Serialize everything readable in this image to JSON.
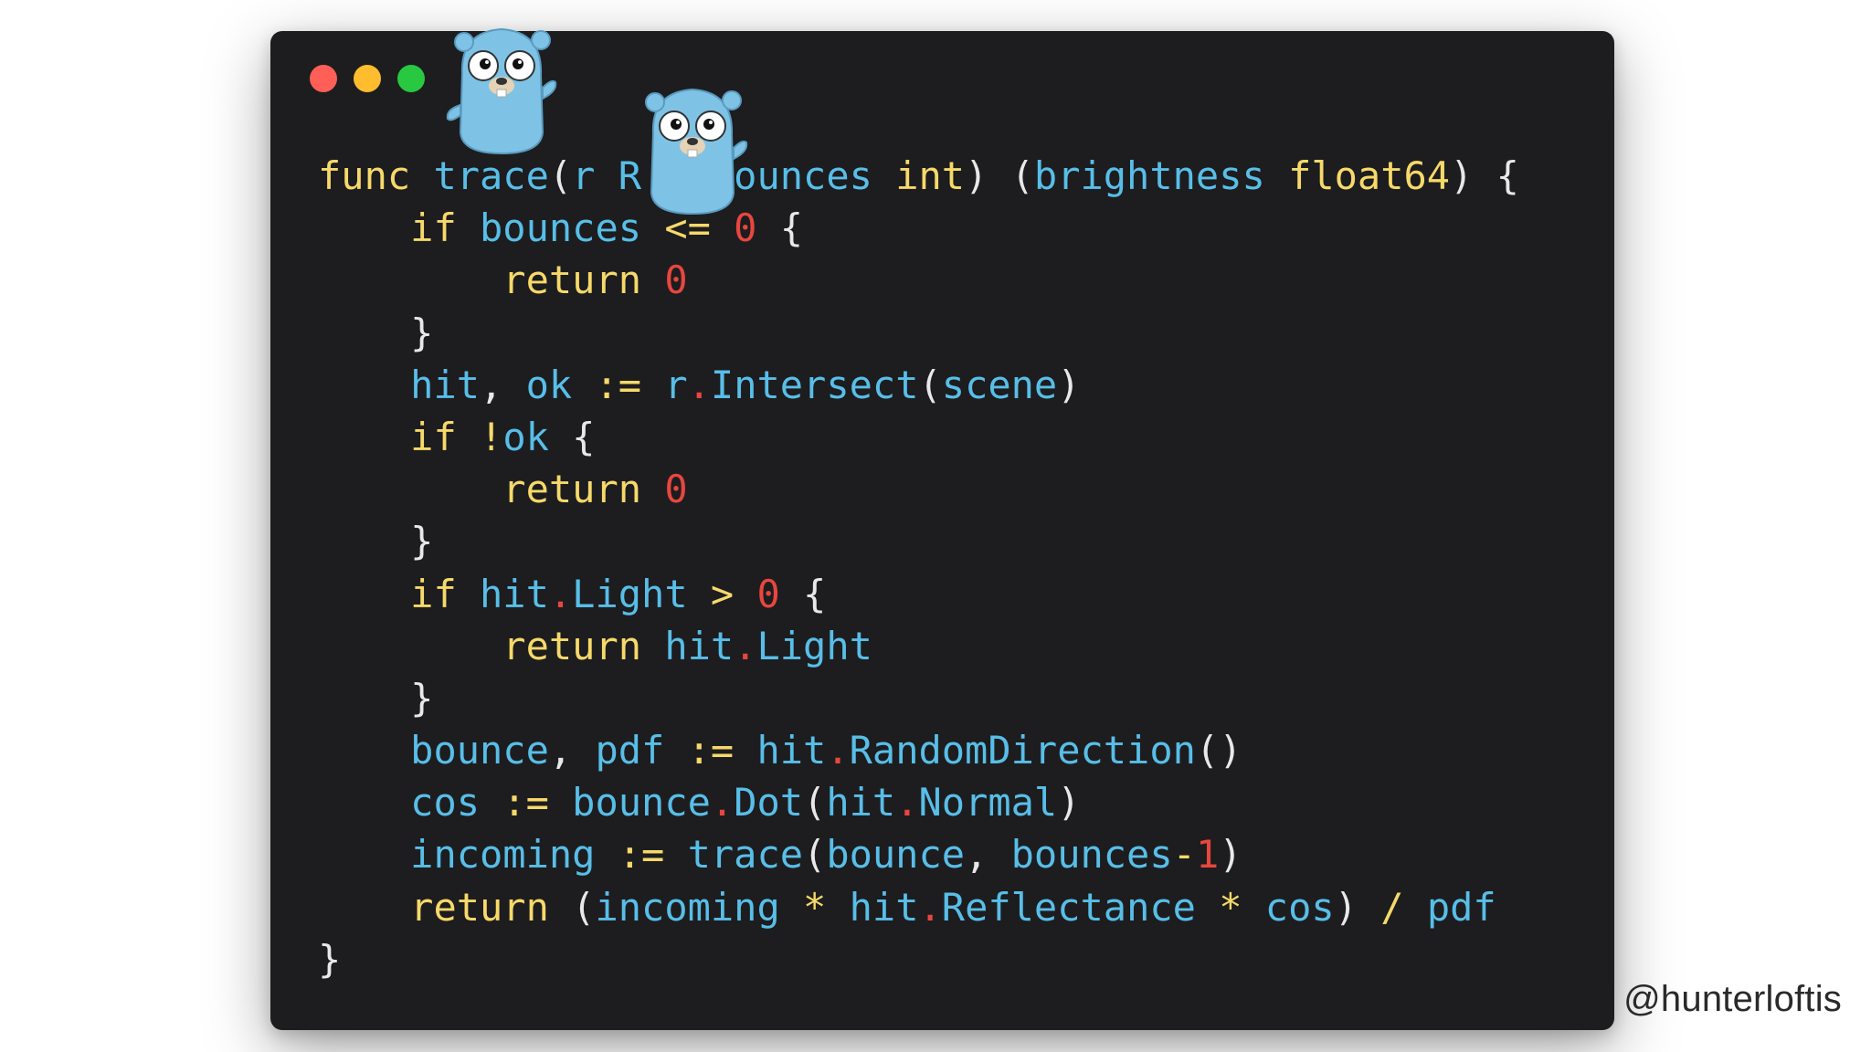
{
  "window": {
    "traffic_lights": [
      {
        "name": "close",
        "color": "#ff5f57"
      },
      {
        "name": "minimize",
        "color": "#febc2e"
      },
      {
        "name": "zoom",
        "color": "#28c840"
      }
    ]
  },
  "code": {
    "language": "go",
    "lines": [
      [
        [
          "kw",
          "func "
        ],
        [
          "id",
          "trace"
        ],
        [
          "punc",
          "("
        ],
        [
          "id",
          "r R"
        ],
        [
          "punc",
          "   "
        ],
        [
          "id",
          "bounces "
        ],
        [
          "kw",
          "int"
        ],
        [
          "punc",
          ") ("
        ],
        [
          "id",
          "brightness "
        ],
        [
          "kw",
          "float64"
        ],
        [
          "punc",
          ") {"
        ]
      ],
      [
        [
          "punc",
          "    "
        ],
        [
          "kw",
          "if "
        ],
        [
          "id",
          "bounces "
        ],
        [
          "op",
          "<= "
        ],
        [
          "num",
          "0"
        ],
        [
          "punc",
          " {"
        ]
      ],
      [
        [
          "punc",
          "        "
        ],
        [
          "kw",
          "return "
        ],
        [
          "num",
          "0"
        ]
      ],
      [
        [
          "punc",
          "    }"
        ]
      ],
      [
        [
          "punc",
          "    "
        ],
        [
          "id",
          "hit"
        ],
        [
          "punc",
          ", "
        ],
        [
          "id",
          "ok "
        ],
        [
          "op",
          ":= "
        ],
        [
          "id",
          "r"
        ],
        [
          "dotop",
          "."
        ],
        [
          "id",
          "Intersect"
        ],
        [
          "punc",
          "("
        ],
        [
          "id",
          "scene"
        ],
        [
          "punc",
          ")"
        ]
      ],
      [
        [
          "punc",
          "    "
        ],
        [
          "kw",
          "if "
        ],
        [
          "op",
          "!"
        ],
        [
          "id",
          "ok"
        ],
        [
          "punc",
          " {"
        ]
      ],
      [
        [
          "punc",
          "        "
        ],
        [
          "kw",
          "return "
        ],
        [
          "num",
          "0"
        ]
      ],
      [
        [
          "punc",
          "    }"
        ]
      ],
      [
        [
          "punc",
          "    "
        ],
        [
          "kw",
          "if "
        ],
        [
          "id",
          "hit"
        ],
        [
          "dotop",
          "."
        ],
        [
          "id",
          "Light "
        ],
        [
          "op",
          "> "
        ],
        [
          "num",
          "0"
        ],
        [
          "punc",
          " {"
        ]
      ],
      [
        [
          "punc",
          "        "
        ],
        [
          "kw",
          "return "
        ],
        [
          "id",
          "hit"
        ],
        [
          "dotop",
          "."
        ],
        [
          "id",
          "Light"
        ]
      ],
      [
        [
          "punc",
          "    }"
        ]
      ],
      [
        [
          "punc",
          "    "
        ],
        [
          "id",
          "bounce"
        ],
        [
          "punc",
          ", "
        ],
        [
          "id",
          "pdf "
        ],
        [
          "op",
          ":= "
        ],
        [
          "id",
          "hit"
        ],
        [
          "dotop",
          "."
        ],
        [
          "id",
          "RandomDirection"
        ],
        [
          "punc",
          "()"
        ]
      ],
      [
        [
          "punc",
          "    "
        ],
        [
          "id",
          "cos "
        ],
        [
          "op",
          ":= "
        ],
        [
          "id",
          "bounce"
        ],
        [
          "dotop",
          "."
        ],
        [
          "id",
          "Dot"
        ],
        [
          "punc",
          "("
        ],
        [
          "id",
          "hit"
        ],
        [
          "dotop",
          "."
        ],
        [
          "id",
          "Normal"
        ],
        [
          "punc",
          ")"
        ]
      ],
      [
        [
          "punc",
          "    "
        ],
        [
          "id",
          "incoming "
        ],
        [
          "op",
          ":= "
        ],
        [
          "id",
          "trace"
        ],
        [
          "punc",
          "("
        ],
        [
          "id",
          "bounce"
        ],
        [
          "punc",
          ", "
        ],
        [
          "id",
          "bounces"
        ],
        [
          "op",
          "-"
        ],
        [
          "num",
          "1"
        ],
        [
          "punc",
          ")"
        ]
      ],
      [
        [
          "punc",
          "    "
        ],
        [
          "kw",
          "return "
        ],
        [
          "punc",
          "("
        ],
        [
          "id",
          "incoming "
        ],
        [
          "op",
          "* "
        ],
        [
          "id",
          "hit"
        ],
        [
          "dotop",
          "."
        ],
        [
          "id",
          "Reflectance "
        ],
        [
          "op",
          "* "
        ],
        [
          "id",
          "cos"
        ],
        [
          "punc",
          ") "
        ],
        [
          "op",
          "/ "
        ],
        [
          "id",
          "pdf"
        ]
      ],
      [
        [
          "punc",
          "}"
        ]
      ]
    ]
  },
  "mascots": [
    {
      "name": "gopher-mascot-1",
      "icon": "go-gopher-icon"
    },
    {
      "name": "gopher-mascot-2",
      "icon": "go-gopher-icon"
    }
  ],
  "attribution": {
    "handle": "@hunterloftis"
  }
}
